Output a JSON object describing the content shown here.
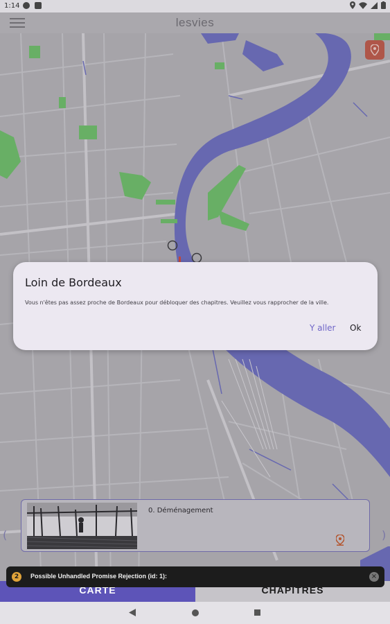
{
  "status_bar": {
    "time": "1:14",
    "icons": [
      "app-a-icon",
      "app-square-icon",
      "location-icon",
      "wifi-icon",
      "signal-icon",
      "battery-icon"
    ]
  },
  "app_bar": {
    "title": "lesvies",
    "menu_icon": "hamburger-menu-icon"
  },
  "map": {
    "locate_icon": "map-pin-icon",
    "colors": {
      "land": "#b5b3b8",
      "roads": "#cfcdd2",
      "river": "#6e6fc0",
      "parks": "#6fc06a",
      "locate_button": "#c05a4a"
    }
  },
  "dialog": {
    "title": "Loin de Bordeaux",
    "message": "Vous n'êtes pas assez proche de Bordeaux pour débloquer des chapitres. Veuillez vous rapprocher de la ville.",
    "go_label": "Y aller",
    "ok_label": "Ok"
  },
  "chapter_card": {
    "title": "0. Déménagement",
    "pin_icon": "map-pin-icon"
  },
  "tabs": {
    "left": "CARTE",
    "right": "CHAPITRES"
  },
  "toast": {
    "count": "2",
    "message": "Possible Unhandled Promise Rejection (id: 1):",
    "close_icon": "close-icon"
  },
  "nav_bar": {
    "back_icon": "back-triangle-icon",
    "home_icon": "home-circle-icon",
    "recent_icon": "recent-square-icon"
  }
}
